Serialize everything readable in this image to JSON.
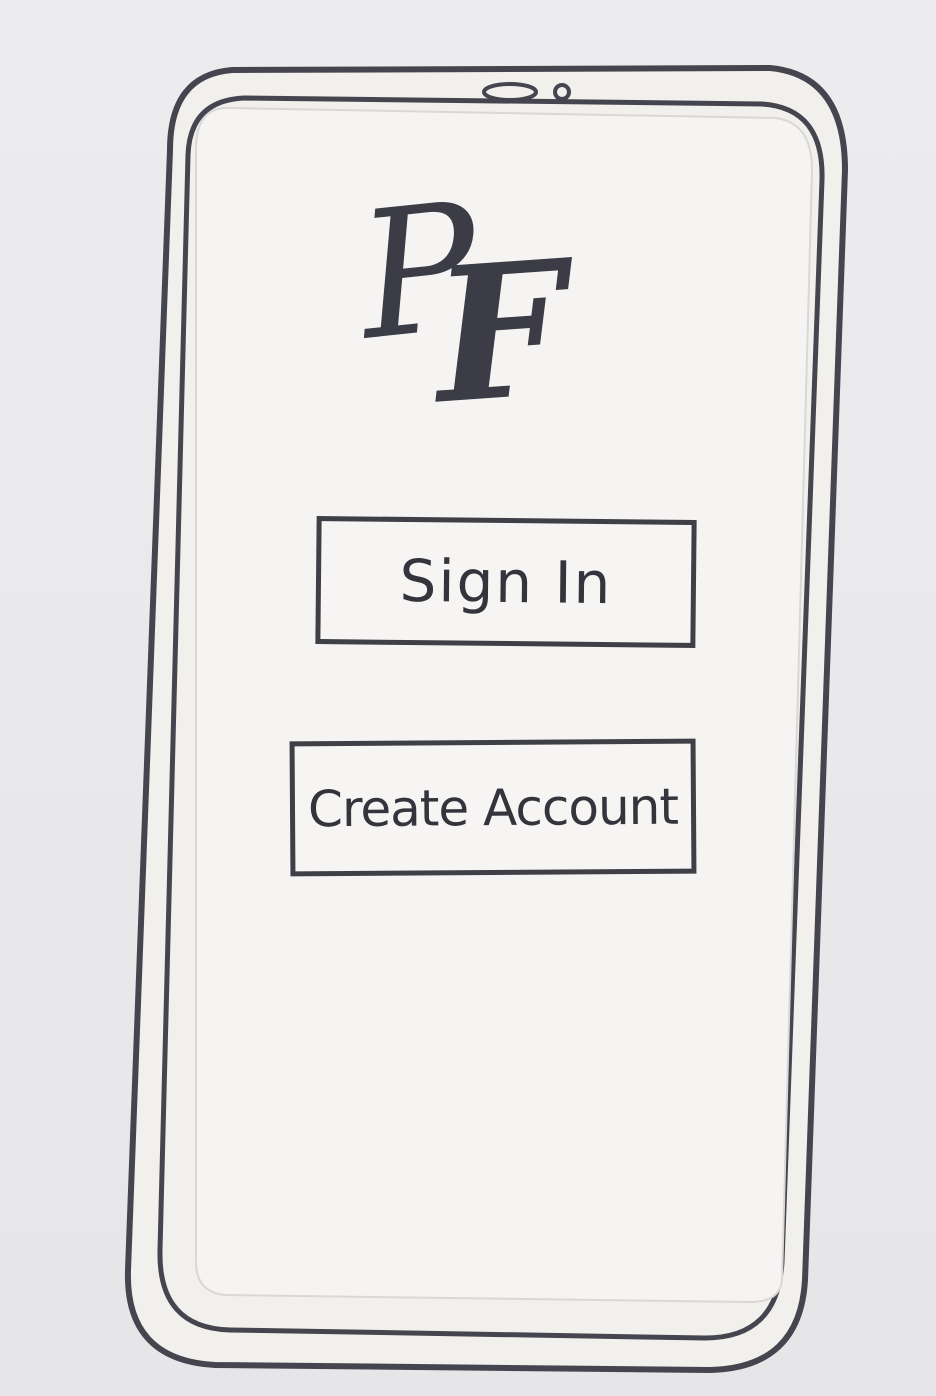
{
  "screen": {
    "logo": {
      "letter_p": "P",
      "letter_f": "F"
    },
    "buttons": {
      "sign_in_label": "Sign In",
      "create_account_label": "Create Account"
    }
  },
  "colors": {
    "ink": "#3f3f48",
    "paper": "#f3f2f1",
    "background": "#e9e9ea"
  }
}
